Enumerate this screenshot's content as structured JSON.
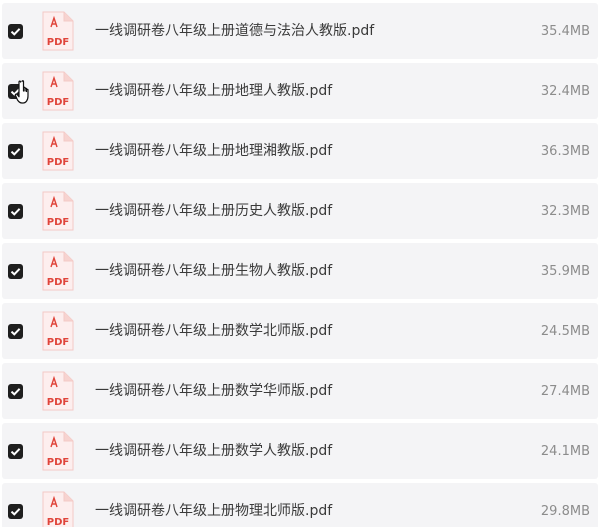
{
  "icon": "pdf-file-icon",
  "icon_label": "PDF",
  "colors": {
    "row_bg": "#f4f4f6",
    "checkbox": "#1f1f1f",
    "pdf_red": "#e0443a",
    "pdf_pale": "#fdeeee",
    "name_text": "#3a3a3a",
    "size_text": "#8c8c8c"
  },
  "files": [
    {
      "name": "一线调研卷八年级上册道德与法治人教版.pdf",
      "size": "35.4MB",
      "checked": true
    },
    {
      "name": "一线调研卷八年级上册地理人教版.pdf",
      "size": "32.4MB",
      "checked": true
    },
    {
      "name": "一线调研卷八年级上册地理湘教版.pdf",
      "size": "36.3MB",
      "checked": true
    },
    {
      "name": "一线调研卷八年级上册历史人教版.pdf",
      "size": "32.3MB",
      "checked": true
    },
    {
      "name": "一线调研卷八年级上册生物人教版.pdf",
      "size": "35.9MB",
      "checked": true
    },
    {
      "name": "一线调研卷八年级上册数学北师版.pdf",
      "size": "24.5MB",
      "checked": true
    },
    {
      "name": "一线调研卷八年级上册数学华师版.pdf",
      "size": "27.4MB",
      "checked": true
    },
    {
      "name": "一线调研卷八年级上册数学人教版.pdf",
      "size": "24.1MB",
      "checked": true
    },
    {
      "name": "一线调研卷八年级上册物理北师版.pdf",
      "size": "29.8MB",
      "checked": true
    }
  ]
}
